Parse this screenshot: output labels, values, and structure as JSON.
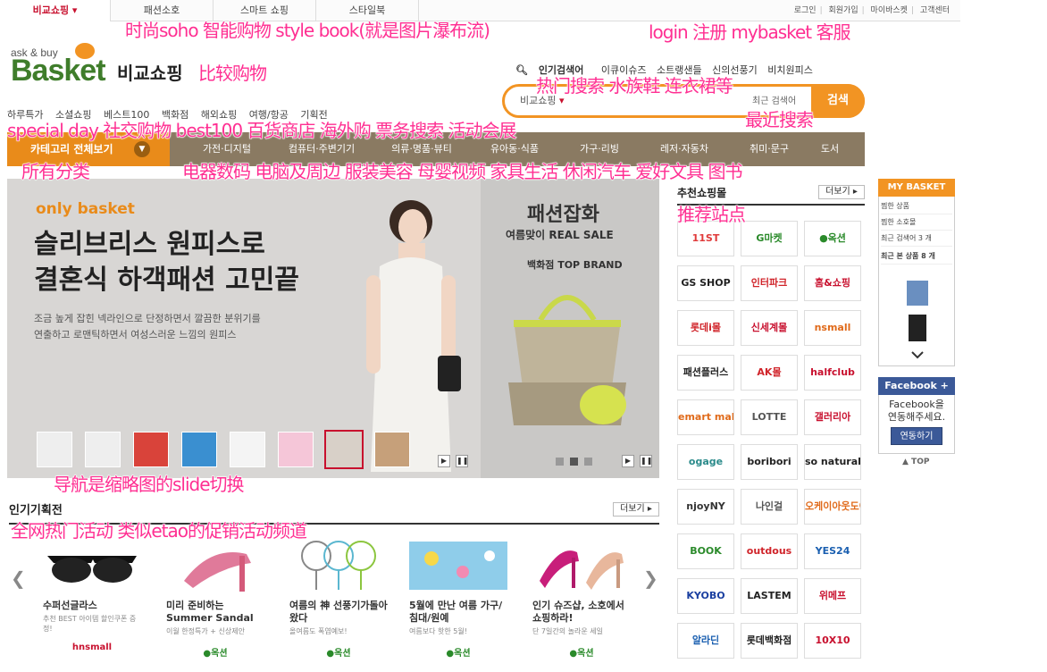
{
  "topbar": {
    "tabs": [
      "비교쇼핑 ▾",
      "패션소호",
      "스마트 쇼핑",
      "스타일북"
    ],
    "links": [
      "로그인",
      "회원가입",
      "마이바스켓",
      "고객센터"
    ]
  },
  "logo": {
    "small": "ask & buy",
    "big": "Basket",
    "kr": "비교쇼핑"
  },
  "search": {
    "links": [
      "인기검색어",
      "이큐이슈즈",
      "소트랭샌들",
      "신의선풍기",
      "비치원피스"
    ],
    "scope": "비교쇼핑",
    "recent": "최근 검색어",
    "button": "검색"
  },
  "quicknav": [
    "하루특가",
    "소셜쇼핑",
    "베스트100",
    "백화점",
    "해외쇼핑",
    "여행/항공",
    "기획전"
  ],
  "categories": {
    "all": "카테고리 전체보기",
    "items": [
      "가전·디지털",
      "컴퓨터·주변기기",
      "의류·명품·뷰티",
      "유아동·식품",
      "가구·리빙",
      "레저·자동차",
      "취미·문구",
      "도서"
    ]
  },
  "banner": {
    "brand": "only basket",
    "headline1": "슬리브리스 원피스로",
    "headline2": "결혼식 하객패션 고민끝",
    "desc1": "조금 높게 잡힌 넥라인으로 단정하면서 깔끔한 분위기를",
    "desc2": "연출하고 로맨틱하면서 여성스러운 느낌의 원피스",
    "sale_title": "패션잡화",
    "sale_sub": "여름맞이 REAL SALE",
    "sale_brand": "백화점 TOP BRAND"
  },
  "popular": {
    "title": "인기기획전",
    "more": "더보기 ▸",
    "items": [
      {
        "name": "수퍼선글라스",
        "sub": "추천 BEST 아이템 할인쿠폰 증정!",
        "shop": "hnsmall"
      },
      {
        "name": "미리 준비하는 Summer Sandal",
        "sub": "이월 한정특가 + 신상제안",
        "shop": "●옥션"
      },
      {
        "name": "여름의 神 선풍기가돌아왔다",
        "sub": "올여름도 폭염예보!",
        "shop": "●옥션"
      },
      {
        "name": "5월에 만난 여름 가구/침대/원예",
        "sub": "여름보다 핫한 5월!",
        "shop": "●옥션"
      },
      {
        "name": "인기 슈즈샵, 소호에서 쇼핑하라!",
        "sub": "단 7일간의 놀라운 세일",
        "shop": "●옥션"
      }
    ]
  },
  "recommended": {
    "title": "추천쇼핑몰",
    "more": "더보기 ▸",
    "malls": [
      "11ST",
      "G마켓",
      "●옥션",
      "GS SHOP",
      "인터파크",
      "홈&쇼핑",
      "롯데i몰",
      "신세계몰",
      "nsmall",
      "패션플러스",
      "AK몰",
      "halfclub",
      "emart mall",
      "LOTTE",
      "갤러리아",
      "ogage",
      "boribori",
      "so natural",
      "njoyNY",
      "나인걸",
      "오케이아웃도어",
      "BOOK",
      "outdous",
      "YES24",
      "KYOBO",
      "LASTEM",
      "위메프",
      "알라딘",
      "롯데백화점",
      "10X10"
    ]
  },
  "mybasket": {
    "title": "MY BASKET",
    "rows": [
      "찜한 상품",
      "찜한 소호몰",
      "최근 검색어 3 개",
      "최근 본 상품 8 개"
    ]
  },
  "facebook": {
    "title": "Facebook +",
    "text": "Facebook을 연동해주세요.",
    "button": "연동하기",
    "top": "▲ TOP"
  },
  "annotations": {
    "a1": "时尚soho  智能购物  style book(就是图片瀑布流)",
    "a2": "login 注册 mybasket 客服",
    "a3": "比较购物",
    "a4": "热门搜索 水族鞋 连衣裙等",
    "a5": "最近搜索",
    "a6": "special day 社交购物 best100 百货商店 海外购 票务搜索 活动会展",
    "a7": "所有分类",
    "a8": "电器数码 电脑及周边 服装美容 母婴视频 家具生活 休闲汽车 爱好文具  图书",
    "a9": "推荐站点",
    "a10": "导航是缩略图的slide切换",
    "a11": "全网热门活动  类似etao的促销活动频道"
  }
}
